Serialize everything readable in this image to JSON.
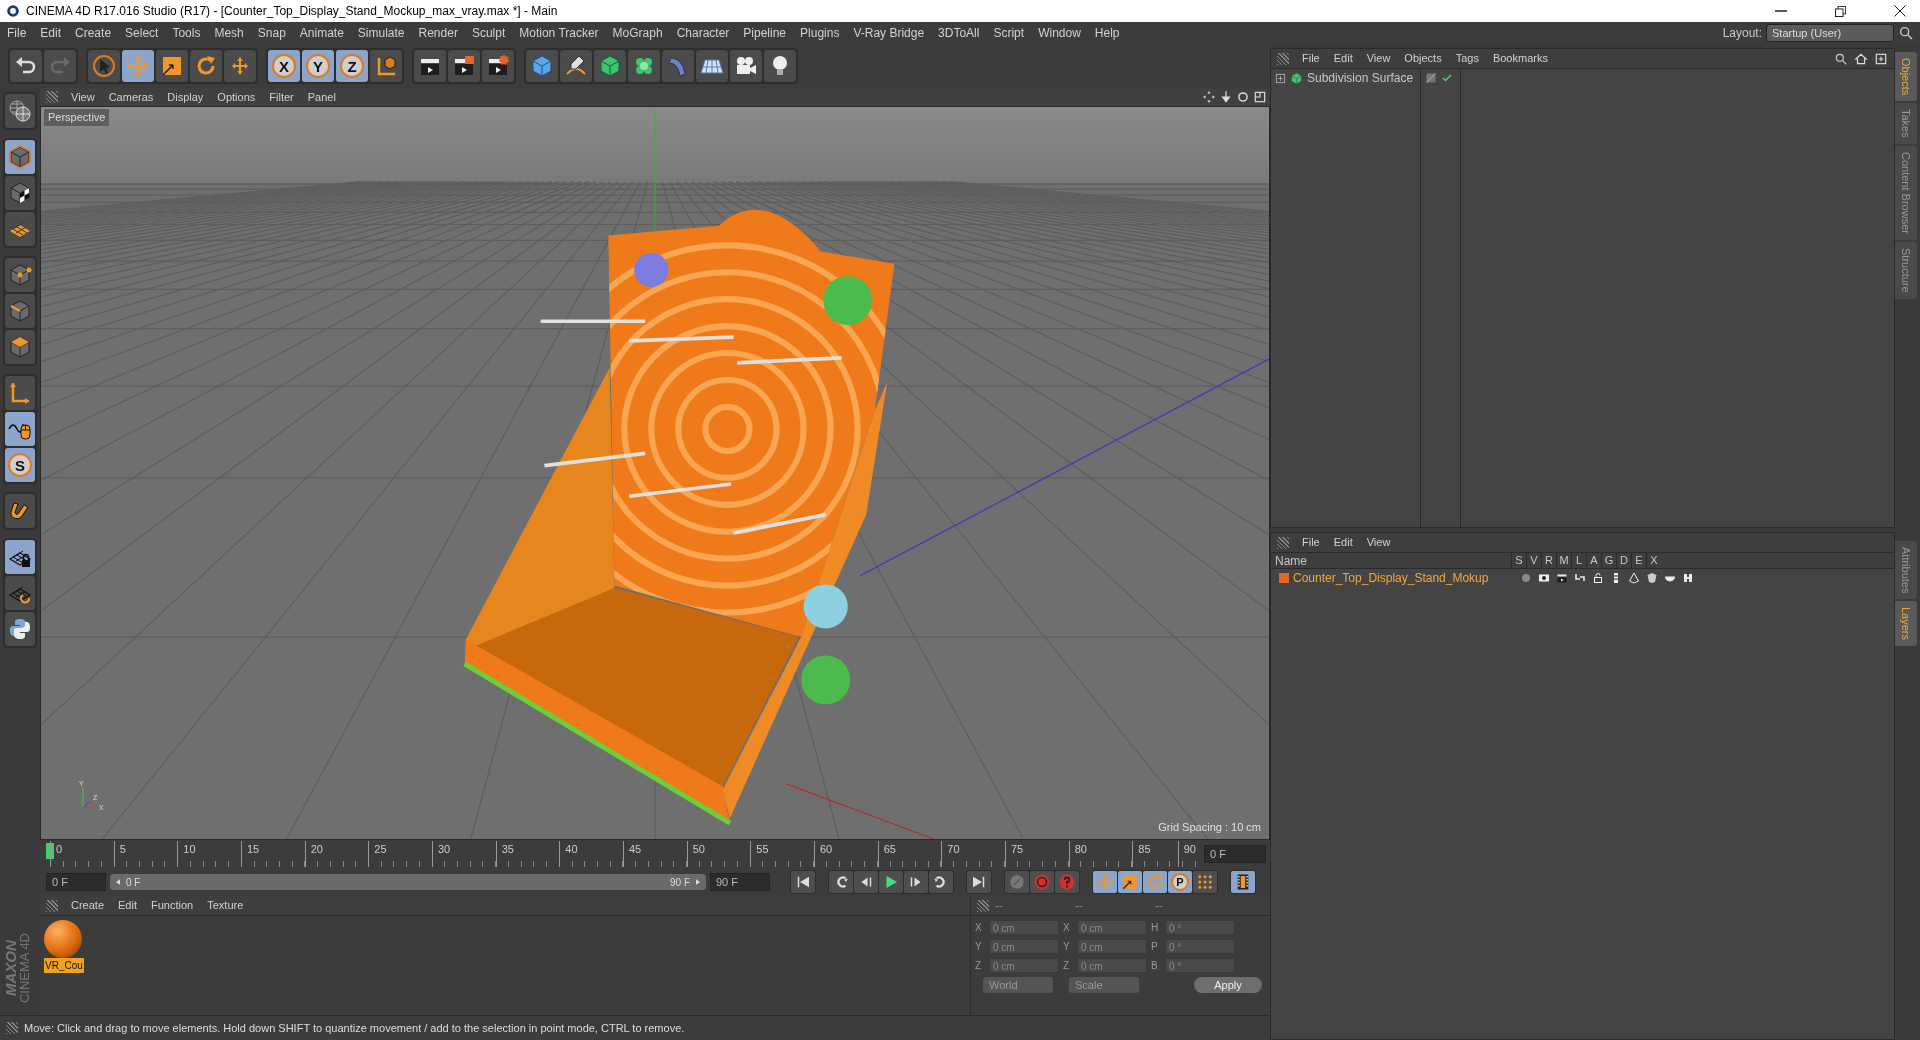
{
  "window": {
    "title": "CINEMA 4D R17.016 Studio (R17) - [Counter_Top_Display_Stand_Mockup_max_vray.max *] - Main"
  },
  "menu_bar": [
    "File",
    "Edit",
    "Create",
    "Select",
    "Tools",
    "Mesh",
    "Snap",
    "Animate",
    "Simulate",
    "Render",
    "Sculpt",
    "Motion Tracker",
    "MoGraph",
    "Character",
    "Pipeline",
    "Plugins",
    "V-Ray Bridge",
    "3DToAll",
    "Script",
    "Window",
    "Help"
  ],
  "layout": {
    "label": "Layout:",
    "value": "Startup (User)"
  },
  "toolbar": [
    {
      "tools": [
        {
          "kind": "undo",
          "selected": false
        },
        {
          "kind": "redo",
          "selected": false
        }
      ]
    },
    {
      "tools": [
        {
          "kind": "select",
          "selected": false
        },
        {
          "kind": "move",
          "selected": true
        },
        {
          "kind": "scale",
          "selected": false
        },
        {
          "kind": "rotate",
          "selected": false
        },
        {
          "kind": "transform",
          "selected": false
        }
      ]
    },
    {
      "tools": [
        {
          "kind": "letter",
          "label": "X",
          "selected": true
        },
        {
          "kind": "letter",
          "label": "Y",
          "selected": true
        },
        {
          "kind": "letter",
          "label": "Z",
          "selected": true
        },
        {
          "kind": "coords",
          "selected": false
        }
      ]
    },
    {
      "tools": [
        {
          "kind": "render_view",
          "selected": false
        },
        {
          "kind": "render_picture",
          "selected": false
        },
        {
          "kind": "render_settings",
          "selected": false
        }
      ]
    },
    {
      "tools": [
        {
          "kind": "cube",
          "selected": false
        },
        {
          "kind": "pen",
          "selected": false
        },
        {
          "kind": "subdiv",
          "selected": false
        },
        {
          "kind": "cloner",
          "selected": false
        },
        {
          "kind": "deformer",
          "selected": false
        },
        {
          "kind": "floor",
          "selected": false
        },
        {
          "kind": "camera",
          "selected": false
        },
        {
          "kind": "light",
          "selected": false
        }
      ]
    }
  ],
  "left_toolbar": [
    {
      "tools": [
        {
          "kind": "workplane",
          "selected": false
        }
      ]
    },
    {
      "tools": [
        {
          "kind": "model",
          "selected": true
        },
        {
          "kind": "texture",
          "selected": false
        },
        {
          "kind": "grid",
          "selected": false
        }
      ]
    },
    {
      "tools": [
        {
          "kind": "points",
          "selected": false
        },
        {
          "kind": "edges",
          "selected": false
        },
        {
          "kind": "polygons",
          "selected": false
        }
      ]
    },
    {
      "tools": [
        {
          "kind": "axis",
          "selected": false
        },
        {
          "kind": "tweak",
          "selected": true
        },
        {
          "kind": "letter",
          "label": "S",
          "selected": true
        }
      ]
    },
    {
      "tools": [
        {
          "kind": "magnet",
          "selected": false
        }
      ]
    },
    {
      "tools": [
        {
          "kind": "lockgrid",
          "selected": true
        },
        {
          "kind": "gridsync",
          "selected": false
        },
        {
          "kind": "python",
          "selected": false
        }
      ]
    }
  ],
  "viewport": {
    "menu": [
      "View",
      "Cameras",
      "Display",
      "Options",
      "Filter",
      "Panel"
    ],
    "camera": "Perspective",
    "grid_spacing": "Grid Spacing : 10 cm",
    "axis_labels": [
      "Y",
      "X",
      "Z"
    ]
  },
  "timeline": {
    "ticks": [
      "0",
      "5",
      "10",
      "15",
      "20",
      "25",
      "30",
      "35",
      "40",
      "45",
      "50",
      "55",
      "60",
      "65",
      "70",
      "75",
      "80",
      "85",
      "90"
    ],
    "level": 0,
    "current": "0 F"
  },
  "transport": {
    "start": "0 F",
    "level": 1,
    "range_start": "0 F",
    "range_end": "90 F",
    "end": "90 F",
    "groups": [
      {
        "tools": [
          {
            "kind": "first",
            "selected": false
          }
        ]
      },
      {
        "tools": [
          {
            "kind": "prevkey",
            "selected": false
          },
          {
            "kind": "prev",
            "selected": false
          },
          {
            "kind": "play",
            "selected": false
          },
          {
            "kind": "next",
            "selected": false
          },
          {
            "kind": "nextkey",
            "selected": false
          }
        ]
      },
      {
        "tools": [
          {
            "kind": "last",
            "selected": false
          }
        ]
      },
      {
        "tools": [
          {
            "kind": "record",
            "selected": false
          },
          {
            "kind": "autokey",
            "selected": false
          },
          {
            "kind": "keyhelp",
            "selected": false
          }
        ]
      },
      {
        "tools": [
          {
            "kind": "move",
            "selected": true
          },
          {
            "kind": "scale",
            "selected": true
          },
          {
            "kind": "rotate",
            "selected": true
          },
          {
            "kind": "letter",
            "label": "P",
            "selected": true
          },
          {
            "kind": "dots",
            "selected": false
          }
        ]
      },
      {
        "tools": [
          {
            "kind": "film",
            "selected": true
          }
        ]
      }
    ]
  },
  "materials": {
    "menu": [
      "Create",
      "Edit",
      "Function",
      "Texture"
    ],
    "items": [
      {
        "name": "VR_Cou",
        "selected": true
      }
    ]
  },
  "coordinates": {
    "headers": [
      "--",
      "--",
      "--"
    ],
    "rows": [
      {
        "a": "X",
        "position": "0 cm",
        "b": "X",
        "size": "0 cm",
        "c": "H",
        "rotation": "0 °"
      },
      {
        "a": "Y",
        "position": "0 cm",
        "b": "Y",
        "size": "0 cm",
        "c": "P",
        "rotation": "0 °"
      },
      {
        "a": "Z",
        "position": "0 cm",
        "b": "Z",
        "size": "0 cm",
        "c": "B",
        "rotation": "0 °"
      }
    ],
    "dropdowns": [
      "World",
      "Scale"
    ],
    "apply": "Apply"
  },
  "brand": [
    "MAXON",
    "CINEMA 4D"
  ],
  "status_bar": "Move: Click and drag to move elements. Hold down SHIFT to quantize movement / add to the selection in point mode, CTRL to remove.",
  "objects": {
    "menu": [
      "File",
      "Edit",
      "View",
      "Objects",
      "Tags",
      "Bookmarks"
    ],
    "items": [
      {
        "name": "Subdivision Surface",
        "enabled": true
      }
    ]
  },
  "layers": {
    "menu": [
      "File",
      "Edit",
      "View"
    ],
    "columns": [
      "Name",
      "S",
      "V",
      "R",
      "M",
      "L",
      "A",
      "G",
      "D",
      "E",
      "X"
    ],
    "rows": [
      {
        "name": "Counter_Top_Display_Stand_Mokup",
        "color": "#e0662a"
      }
    ]
  },
  "side_tabs": {
    "upper": [
      {
        "label": "Objects",
        "selected": true
      },
      {
        "label": "Takes",
        "selected": false
      },
      {
        "label": "Content Browser",
        "selected": false
      },
      {
        "label": "Structure",
        "selected": false
      }
    ],
    "lower": [
      {
        "label": "Attributes",
        "selected": false
      },
      {
        "label": "Layers",
        "selected": true
      }
    ]
  }
}
